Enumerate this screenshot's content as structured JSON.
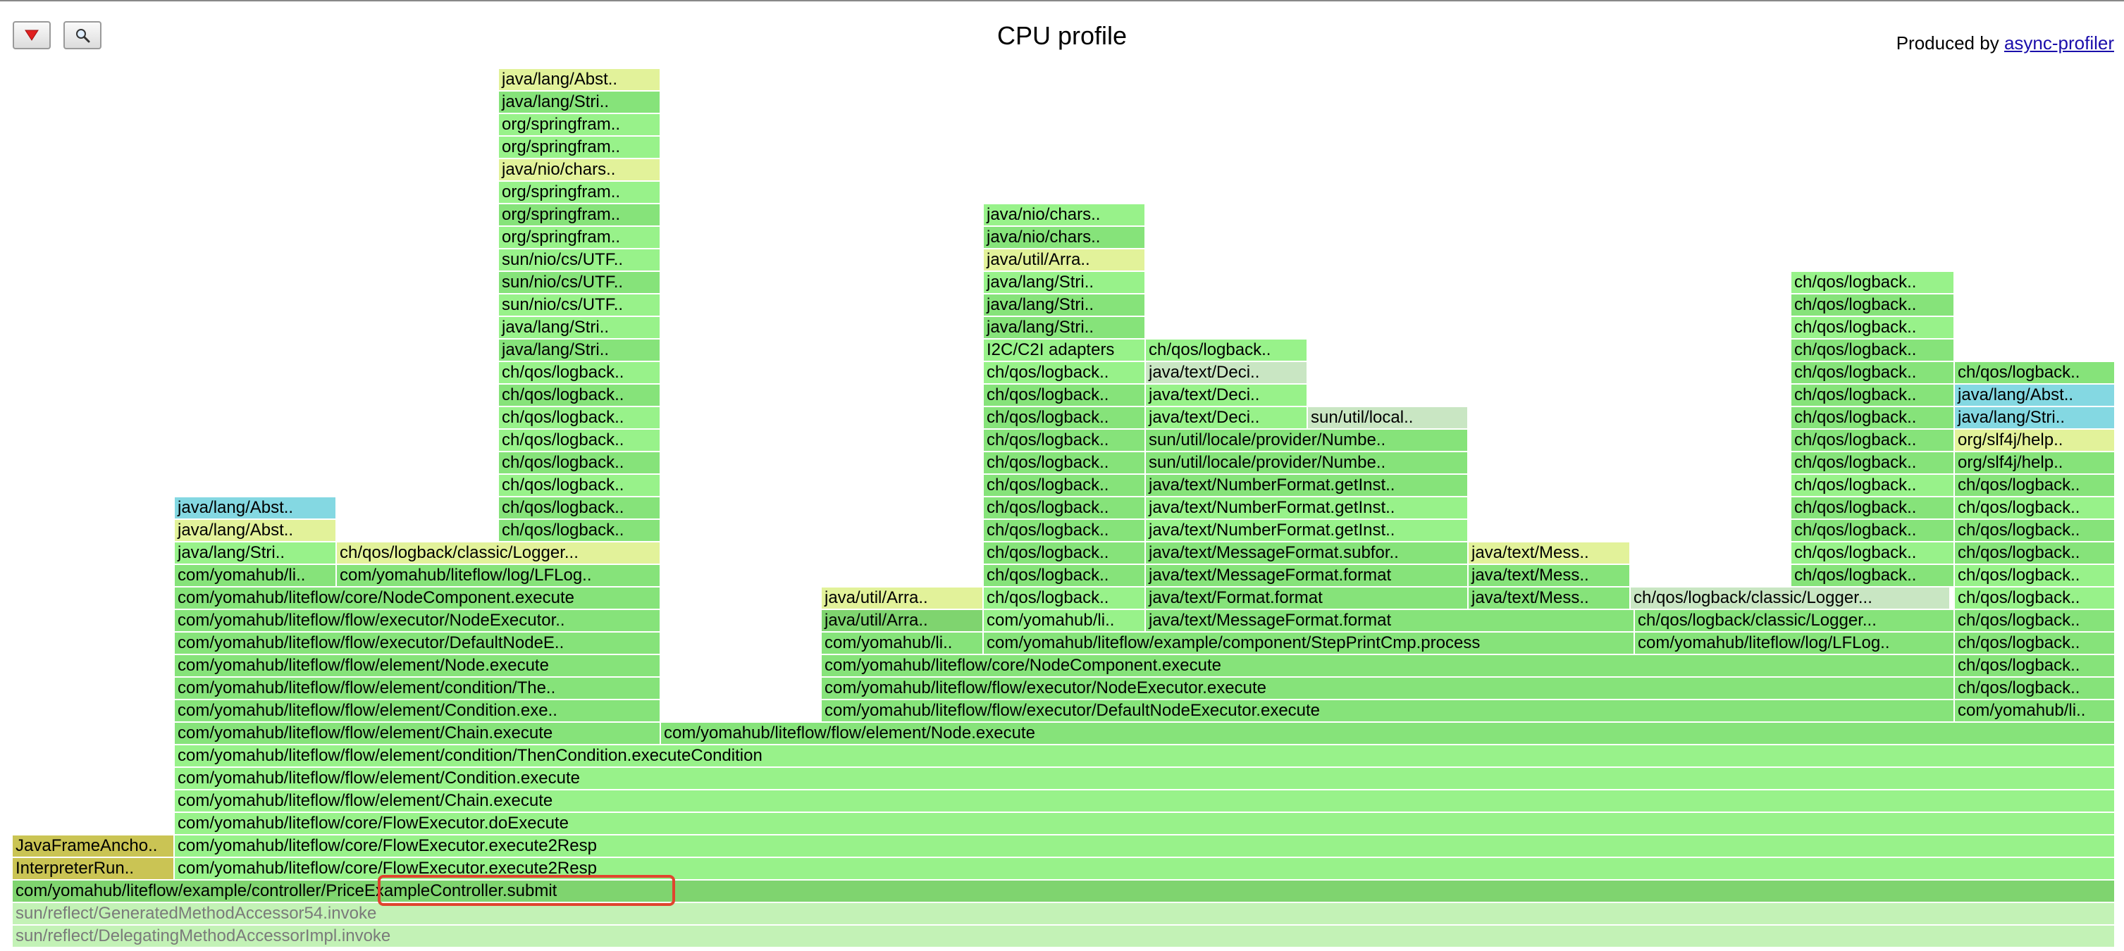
{
  "header": {
    "title": "CPU profile",
    "produced_by_label": "Produced by",
    "produced_by_link": "async-profiler",
    "reverse_button_icon": "red-down-triangle-icon",
    "search_button_icon": "magnifier-icon"
  },
  "colors": {
    "green_a": "#86e37a",
    "green_b": "#98f28a",
    "green_c": "#7fd46f",
    "yellow": "#e2f29a",
    "cyan": "#84d8e2",
    "olive": "#cac454",
    "pale": "#c3f2b6",
    "grey_green": "#c9e6c3",
    "highlight": "#e0452e"
  },
  "frames": [
    {
      "label": "sun/reflect/DelegatingMethodAccessorImpl.invoke",
      "c": "pale",
      "grey": true
    },
    {
      "label": "sun/reflect/GeneratedMethodAccessor54.invoke",
      "c": "pale",
      "grey": true
    },
    {
      "label": "com/yomahub/liteflow/example/controller/PriceExampleController.submit",
      "c": "green_c"
    },
    {
      "label": "InterpreterRun..",
      "c": "olive"
    },
    {
      "label": "com/yomahub/liteflow/core/FlowExecutor.execute2Resp",
      "c": "green_b"
    },
    {
      "label": "JavaFrameAncho..",
      "c": "olive"
    },
    {
      "label": "com/yomahub/liteflow/core/FlowExecutor.execute2Resp",
      "c": "green_b"
    },
    {
      "label": "com/yomahub/liteflow/core/FlowExecutor.doExecute",
      "c": "green_b"
    },
    {
      "label": "com/yomahub/liteflow/flow/element/Chain.execute",
      "c": "green_b"
    },
    {
      "label": "com/yomahub/liteflow/flow/element/Condition.execute",
      "c": "green_b"
    },
    {
      "label": "com/yomahub/liteflow/flow/element/condition/ThenCondition.executeCondition",
      "c": "green_b"
    },
    {
      "label": "com/yomahub/liteflow/flow/element/Chain.execute",
      "c": "green_a"
    },
    {
      "label": "com/yomahub/liteflow/flow/element/Node.execute",
      "c": "green_a"
    },
    {
      "label": "com/yomahub/liteflow/flow/element/Condition.exe..",
      "c": "green_a"
    },
    {
      "label": "com/yomahub/liteflow/flow/executor/DefaultNodeExecutor.execute",
      "c": "green_a"
    },
    {
      "label": "com/yomahub/li..",
      "c": "green_a"
    },
    {
      "label": "com/yomahub/liteflow/flow/element/condition/The..",
      "c": "green_a"
    },
    {
      "label": "com/yomahub/liteflow/flow/executor/NodeExecutor.execute",
      "c": "green_a"
    },
    {
      "label": "ch/qos/logback..",
      "c": "green_a"
    },
    {
      "label": "com/yomahub/liteflow/flow/element/Node.execute",
      "c": "green_a"
    },
    {
      "label": "com/yomahub/liteflow/core/NodeComponent.execute",
      "c": "green_a"
    },
    {
      "label": "ch/qos/logback..",
      "c": "green_a"
    },
    {
      "label": "com/yomahub/liteflow/flow/executor/DefaultNodeE..",
      "c": "green_a"
    },
    {
      "label": "com/yomahub/li..",
      "c": "green_a"
    },
    {
      "label": "com/yomahub/liteflow/example/component/StepPrintCmp.process",
      "c": "green_a"
    },
    {
      "label": "com/yomahub/liteflow/log/LFLog..",
      "c": "green_a"
    },
    {
      "label": "ch/qos/logback..",
      "c": "green_a"
    },
    {
      "label": "com/yomahub/liteflow/flow/executor/NodeExecutor..",
      "c": "green_a"
    },
    {
      "label": "java/util/Arra..",
      "c": "green_c"
    },
    {
      "label": "com/yomahub/li..",
      "c": "green_b"
    },
    {
      "label": "java/text/MessageFormat.format",
      "c": "green_a"
    },
    {
      "label": "ch/qos/logback/classic/Logger...",
      "c": "green_a"
    },
    {
      "label": "ch/qos/logback..",
      "c": "green_a"
    },
    {
      "label": "com/yomahub/liteflow/core/NodeComponent.execute",
      "c": "green_a"
    },
    {
      "label": "java/util/Arra..",
      "c": "yellow"
    },
    {
      "label": "ch/qos/logback..",
      "c": "green_b"
    },
    {
      "label": "java/text/Format.format",
      "c": "green_a"
    },
    {
      "label": "java/text/Mess..",
      "c": "green_a"
    },
    {
      "label": "ch/qos/logback/classic/Logger...",
      "c": "grey_green"
    },
    {
      "label": "ch/qos/logback..",
      "c": "green_b"
    },
    {
      "label": "com/yomahub/li..",
      "c": "green_a"
    },
    {
      "label": "com/yomahub/liteflow/log/LFLog..",
      "c": "green_a"
    },
    {
      "label": "ch/qos/logback..",
      "c": "green_a"
    },
    {
      "label": "java/text/MessageFormat.format",
      "c": "green_a"
    },
    {
      "label": "java/text/Mess..",
      "c": "green_a"
    },
    {
      "label": "ch/qos/logback..",
      "c": "green_a"
    },
    {
      "label": "ch/qos/logback..",
      "c": "green_b"
    },
    {
      "label": "java/lang/Stri..",
      "c": "green_b"
    },
    {
      "label": "ch/qos/logback/classic/Logger...",
      "c": "yellow"
    },
    {
      "label": "ch/qos/logback..",
      "c": "green_a"
    },
    {
      "label": "java/text/MessageFormat.subfor..",
      "c": "green_a"
    },
    {
      "label": "java/text/Mess..",
      "c": "yellow"
    },
    {
      "label": "ch/qos/logback..",
      "c": "green_b"
    },
    {
      "label": "ch/qos/logback..",
      "c": "green_a"
    },
    {
      "label": "java/lang/Abst..",
      "c": "yellow"
    },
    {
      "label": "ch/qos/logback..",
      "c": "green_a"
    },
    {
      "label": "ch/qos/logback..",
      "c": "green_a"
    },
    {
      "label": "java/text/NumberFormat.getInst..",
      "c": "green_b"
    },
    {
      "label": "ch/qos/logback..",
      "c": "green_a"
    },
    {
      "label": "ch/qos/logback..",
      "c": "green_a"
    },
    {
      "label": "java/lang/Abst..",
      "c": "cyan"
    },
    {
      "label": "ch/qos/logback..",
      "c": "green_a"
    },
    {
      "label": "ch/qos/logback..",
      "c": "green_a"
    },
    {
      "label": "java/text/NumberFormat.getInst..",
      "c": "green_b"
    },
    {
      "label": "ch/qos/logback..",
      "c": "green_a"
    },
    {
      "label": "ch/qos/logback..",
      "c": "green_b"
    },
    {
      "label": "ch/qos/logback..",
      "c": "green_b"
    },
    {
      "label": "ch/qos/logback..",
      "c": "green_a"
    },
    {
      "label": "java/text/NumberFormat.getInst..",
      "c": "green_a"
    },
    {
      "label": "ch/qos/logback..",
      "c": "green_b"
    },
    {
      "label": "ch/qos/logback..",
      "c": "green_a"
    },
    {
      "label": "ch/qos/logback..",
      "c": "green_a"
    },
    {
      "label": "ch/qos/logback..",
      "c": "green_a"
    },
    {
      "label": "sun/util/locale/provider/Numbe..",
      "c": "green_a"
    },
    {
      "label": "ch/qos/logback..",
      "c": "green_a"
    },
    {
      "label": "org/slf4j/help..",
      "c": "green_a"
    },
    {
      "label": "ch/qos/logback..",
      "c": "green_b"
    },
    {
      "label": "ch/qos/logback..",
      "c": "green_a"
    },
    {
      "label": "sun/util/locale/provider/Numbe..",
      "c": "green_a"
    },
    {
      "label": "ch/qos/logback..",
      "c": "green_a"
    },
    {
      "label": "org/slf4j/help..",
      "c": "yellow"
    },
    {
      "label": "ch/qos/logback..",
      "c": "green_b"
    },
    {
      "label": "ch/qos/logback..",
      "c": "green_a"
    },
    {
      "label": "java/text/Deci..",
      "c": "green_b"
    },
    {
      "label": "sun/util/local..",
      "c": "grey_green"
    },
    {
      "label": "ch/qos/logback..",
      "c": "green_a"
    },
    {
      "label": "java/lang/Stri..",
      "c": "cyan"
    },
    {
      "label": "ch/qos/logback..",
      "c": "green_a"
    },
    {
      "label": "ch/qos/logback..",
      "c": "green_a"
    },
    {
      "label": "java/text/Deci..",
      "c": "green_b"
    },
    {
      "label": "ch/qos/logback..",
      "c": "green_a"
    },
    {
      "label": "java/lang/Abst..",
      "c": "cyan"
    },
    {
      "label": "ch/qos/logback..",
      "c": "green_b"
    },
    {
      "label": "ch/qos/logback..",
      "c": "green_b"
    },
    {
      "label": "java/text/Deci..",
      "c": "grey_green"
    },
    {
      "label": "ch/qos/logback..",
      "c": "green_a"
    },
    {
      "label": "ch/qos/logback..",
      "c": "green_a"
    },
    {
      "label": "java/lang/Stri..",
      "c": "green_a"
    },
    {
      "label": "I2C/C2I adapters",
      "c": "green_b"
    },
    {
      "label": "ch/qos/logback..",
      "c": "green_b"
    },
    {
      "label": "ch/qos/logback..",
      "c": "green_a"
    },
    {
      "label": "java/lang/Stri..",
      "c": "green_b"
    },
    {
      "label": "java/lang/Stri..",
      "c": "green_a"
    },
    {
      "label": "ch/qos/logback..",
      "c": "green_b"
    },
    {
      "label": "sun/nio/cs/UTF..",
      "c": "green_b"
    },
    {
      "label": "java/lang/Stri..",
      "c": "green_a"
    },
    {
      "label": "ch/qos/logback..",
      "c": "green_a"
    },
    {
      "label": "sun/nio/cs/UTF..",
      "c": "green_a"
    },
    {
      "label": "java/lang/Stri..",
      "c": "green_b"
    },
    {
      "label": "ch/qos/logback..",
      "c": "green_b"
    },
    {
      "label": "sun/nio/cs/UTF..",
      "c": "green_b"
    },
    {
      "label": "java/util/Arra..",
      "c": "yellow"
    },
    {
      "label": "org/springfram..",
      "c": "green_b"
    },
    {
      "label": "java/nio/chars..",
      "c": "green_a"
    },
    {
      "label": "org/springfram..",
      "c": "green_a"
    },
    {
      "label": "java/nio/chars..",
      "c": "green_b"
    },
    {
      "label": "org/springfram..",
      "c": "green_b"
    },
    {
      "label": "java/nio/chars..",
      "c": "yellow"
    },
    {
      "label": "org/springfram..",
      "c": "green_b"
    },
    {
      "label": "org/springfram..",
      "c": "green_b"
    },
    {
      "label": "java/lang/Stri..",
      "c": "green_a"
    },
    {
      "label": "java/lang/Abst..",
      "c": "yellow"
    }
  ]
}
